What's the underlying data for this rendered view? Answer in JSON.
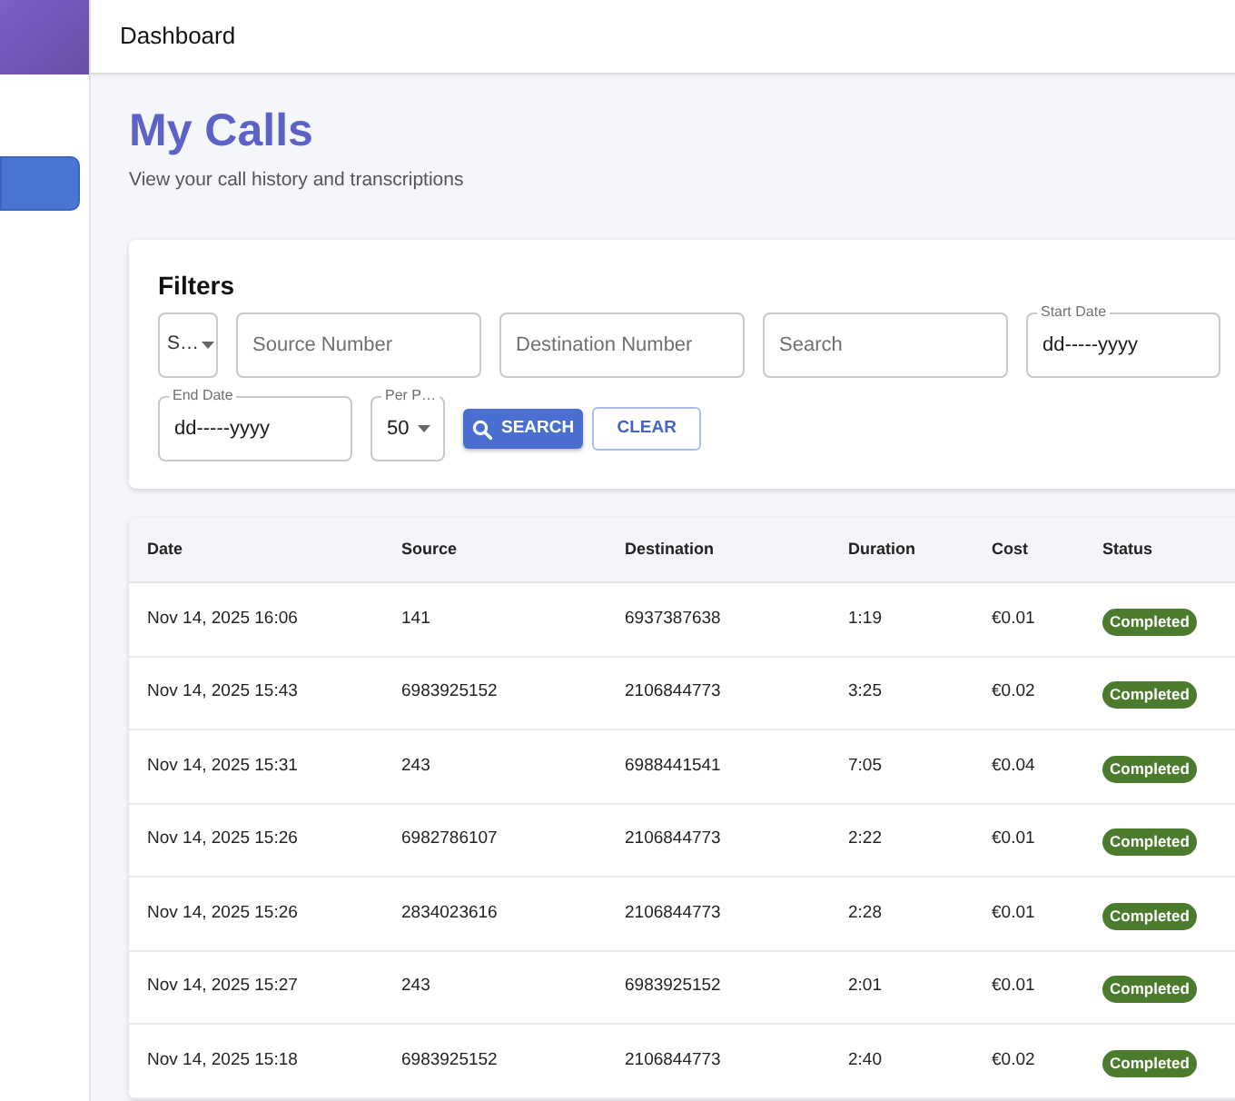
{
  "sidebar": {
    "items": [
      {
        "selected": true
      }
    ]
  },
  "header": {
    "title": "Dashboard"
  },
  "page": {
    "title": "My Calls",
    "subtitle": "View your call history and transcriptions"
  },
  "filters": {
    "title": "Filters",
    "rows": [
      {
        "fields": [
          {
            "kind": "select",
            "value": "S…"
          },
          {
            "kind": "text",
            "placeholder": "Source Number"
          },
          {
            "kind": "text",
            "placeholder": "Destination Number"
          },
          {
            "kind": "text",
            "placeholder": "Search"
          },
          {
            "kind": "date",
            "label": "Start Date",
            "value": "dd-----yyyy"
          }
        ]
      },
      {
        "fields": [
          {
            "kind": "date",
            "label": "End Date",
            "value": "dd-----yyyy"
          },
          {
            "kind": "select",
            "label": "Per P…",
            "value": "50"
          }
        ],
        "buttons": [
          {
            "kind": "primary",
            "label": "SEARCH"
          },
          {
            "kind": "outline",
            "label": "CLEAR"
          }
        ]
      }
    ]
  },
  "table": {
    "columns": [
      "Date",
      "Source",
      "Destination",
      "Duration",
      "Cost",
      "Status"
    ],
    "rows": [
      {
        "date": "Nov 14, 2025 16:06",
        "source": "141",
        "destination": "6937387638",
        "duration": "1:19",
        "cost": "€0.01",
        "status": "Completed"
      },
      {
        "date": "Nov 14, 2025 15:43",
        "source": "6983925152",
        "destination": "2106844773",
        "duration": "3:25",
        "cost": "€0.02",
        "status": "Completed"
      },
      {
        "date": "Nov 14, 2025 15:31",
        "source": "243",
        "destination": "6988441541",
        "duration": "7:05",
        "cost": "€0.04",
        "status": "Completed"
      },
      {
        "date": "Nov 14, 2025 15:26",
        "source": "6982786107",
        "destination": "2106844773",
        "duration": "2:22",
        "cost": "€0.01",
        "status": "Completed"
      },
      {
        "date": "Nov 14, 2025 15:26",
        "source": "2834023616",
        "destination": "2106844773",
        "duration": "2:28",
        "cost": "€0.01",
        "status": "Completed"
      },
      {
        "date": "Nov 14, 2025 15:27",
        "source": "243",
        "destination": "6983925152",
        "duration": "2:01",
        "cost": "€0.01",
        "status": "Completed"
      },
      {
        "date": "Nov 14, 2025 15:18",
        "source": "6983925152",
        "destination": "2106844773",
        "duration": "2:40",
        "cost": "€0.02",
        "status": "Completed"
      }
    ]
  }
}
